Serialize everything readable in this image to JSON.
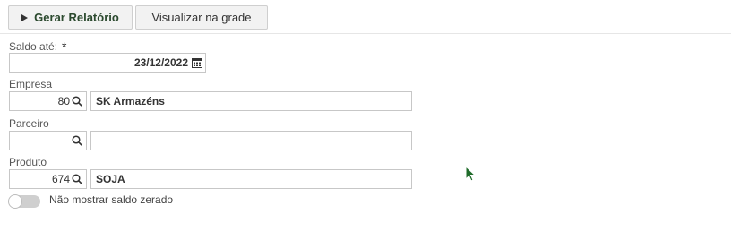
{
  "toolbar": {
    "generate_label": "Gerar Relatório",
    "grid_label": "Visualizar na grade"
  },
  "form": {
    "saldo": {
      "label": "Saldo até:",
      "required_mark": "*",
      "value": "23/12/2022"
    },
    "empresa": {
      "label": "Empresa",
      "code": "80",
      "description": "SK Armazéns"
    },
    "parceiro": {
      "label": "Parceiro",
      "code": "",
      "description": ""
    },
    "produto": {
      "label": "Produto",
      "code": "674",
      "description": "SOJA"
    },
    "toggle": {
      "label": "Não mostrar saldo zerado",
      "checked": false
    }
  },
  "colors": {
    "primary_text": "#2c4a2f",
    "cursor": "#1f6b2a"
  }
}
